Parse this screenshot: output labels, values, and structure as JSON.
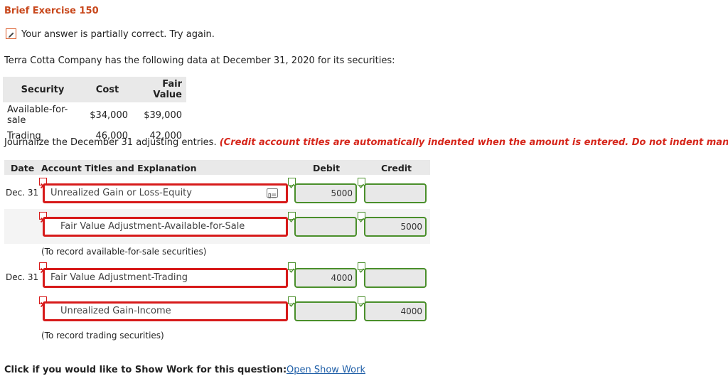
{
  "header": {
    "title": "Brief Exercise 150"
  },
  "status": {
    "message": "Your answer is partially correct.  Try again."
  },
  "problem": {
    "intro": "Terra Cotta Company has the following data at December 31, 2020 for its securities:"
  },
  "securities_table": {
    "headers": {
      "security": "Security",
      "cost": "Cost",
      "fair_value": "Fair Value"
    },
    "rows": [
      {
        "security": "Available-for-sale",
        "cost": "$34,000",
        "fair_value": "$39,000"
      },
      {
        "security": "Trading",
        "cost": "46,000",
        "fair_value": "42,000"
      }
    ]
  },
  "instructions": {
    "text": "Journalize the December 31 adjusting entries.",
    "emphasis": "(Credit account titles are automatically indented when the amount is entered. Do not indent manually.)"
  },
  "journal": {
    "headers": {
      "date": "Date",
      "account": "Account Titles and Explanation",
      "debit": "Debit",
      "credit": "Credit"
    },
    "entries": [
      {
        "date": "Dec. 31",
        "debit_account": "Unrealized Gain or Loss-Equity",
        "debit_amount": "5000",
        "credit_account": "Fair Value Adjustment-Available-for-Sale",
        "credit_amount": "5000",
        "note": "(To record available-for-sale securities)"
      },
      {
        "date": "Dec. 31",
        "debit_account": "Fair Value Adjustment-Trading",
        "debit_amount": "4000",
        "credit_account": "Unrealized Gain-Income",
        "credit_amount": "4000",
        "note": "(To record trading securities)"
      }
    ]
  },
  "footer": {
    "label": "Click if you would like to Show Work for this question:",
    "link": "Open Show Work"
  },
  "colors": {
    "title": "#c8471b",
    "error": "#d71a1a",
    "correct": "#4a8f2b",
    "link": "#1f5fa8"
  },
  "icons": {
    "status": "pencil-icon",
    "wrong": "x-mark-icon",
    "right": "check-mark-icon",
    "account_lookup": "account-list-icon"
  }
}
